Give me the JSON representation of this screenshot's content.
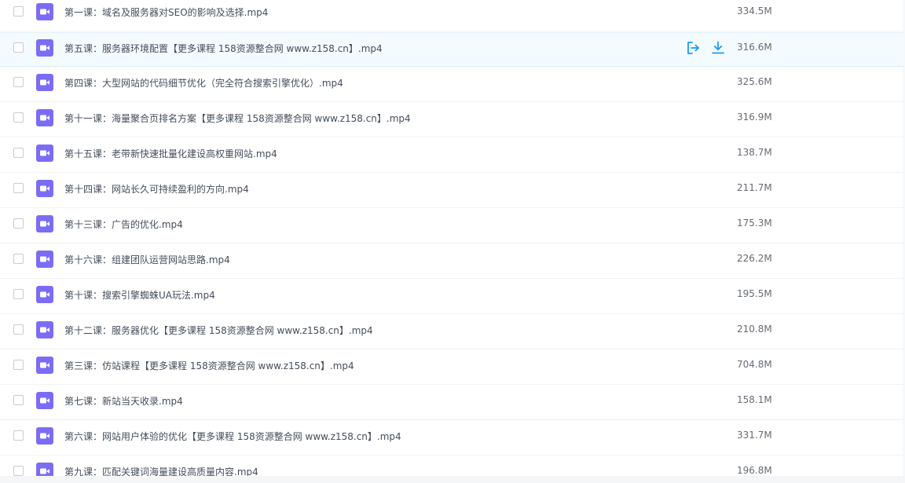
{
  "files": [
    {
      "name": "第一课：域名及服务器对SEO的影响及选择.mp4",
      "size": "334.5M",
      "icon": "video-file-icon"
    },
    {
      "name": "第五课：服务器环境配置【更多课程 158资源整合网 www.z158.cn】.mp4",
      "size": "316.6M",
      "icon": "video-file-icon",
      "hovered": true
    },
    {
      "name": "第四课：大型网站的代码细节优化（完全符合搜索引擎优化）.mp4",
      "size": "325.6M",
      "icon": "video-file-icon"
    },
    {
      "name": "第十一课：海量聚合页排名方案【更多课程 158资源整合网 www.z158.cn】.mp4",
      "size": "316.9M",
      "icon": "video-file-icon"
    },
    {
      "name": "第十五课：老带新快速批量化建设高权重网站.mp4",
      "size": "138.7M",
      "icon": "video-file-icon"
    },
    {
      "name": "第十四课：网站长久可持续盈利的方向.mp4",
      "size": "211.7M",
      "icon": "video-file-icon"
    },
    {
      "name": "第十三课：广告的优化.mp4",
      "size": "175.3M",
      "icon": "video-file-icon"
    },
    {
      "name": "第十六课：组建团队运营网站思路.mp4",
      "size": "226.2M",
      "icon": "video-file-icon"
    },
    {
      "name": "第十课：搜索引擎蜘蛛UA玩法.mp4",
      "size": "195.5M",
      "icon": "video-file-icon"
    },
    {
      "name": "第十二课：服务器优化【更多课程 158资源整合网 www.z158.cn】.mp4",
      "size": "210.8M",
      "icon": "video-file-icon"
    },
    {
      "name": "第三课：仿站课程【更多课程 158资源整合网 www.z158.cn】.mp4",
      "size": "704.8M",
      "icon": "video-file-icon"
    },
    {
      "name": "第七课：新站当天收录.mp4",
      "size": "158.1M",
      "icon": "video-file-icon"
    },
    {
      "name": "第六课：网站用户体验的优化【更多课程 158资源整合网 www.z158.cn】.mp4",
      "size": "331.7M",
      "icon": "video-file-icon"
    },
    {
      "name": "第九课：匹配关键词海量建设高质量内容.mp4",
      "size": "196.8M",
      "icon": "video-file-icon"
    }
  ],
  "row_actions": {
    "share_icon": "share-export-icon",
    "download_icon": "download-icon"
  },
  "colors": {
    "icon_purple": "#7b6cf6",
    "action_blue": "#1e9bf0",
    "hover_bg": "#f4fbff"
  }
}
